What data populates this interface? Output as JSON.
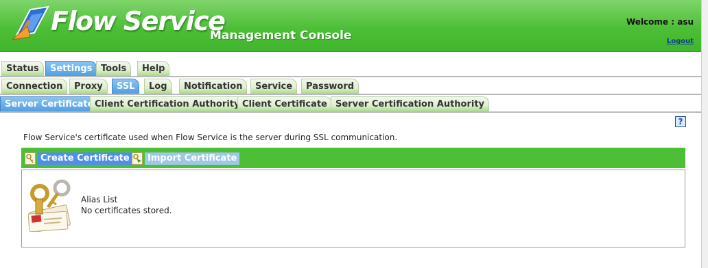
{
  "header": {
    "brand": "Flow Service",
    "subtitle": "Management Console",
    "welcome": "Welcome : asu",
    "logout": "Logout"
  },
  "tabs_main": [
    {
      "label": "Status",
      "active": false
    },
    {
      "label": "Settings",
      "active": true
    },
    {
      "label": "Tools",
      "active": false
    },
    {
      "label": "Help",
      "active": false
    }
  ],
  "tabs_settings": [
    {
      "label": "Connection",
      "active": false
    },
    {
      "label": "Proxy",
      "active": false
    },
    {
      "label": "SSL",
      "active": true
    },
    {
      "label": "Log",
      "active": false
    },
    {
      "label": "Notification",
      "active": false
    },
    {
      "label": "Service",
      "active": false
    },
    {
      "label": "Password",
      "active": false
    }
  ],
  "tabs_ssl": [
    {
      "label": "Server Certificate",
      "active": true
    },
    {
      "label": "Client Certification Authority",
      "active": false
    },
    {
      "label": "Client Certificate",
      "active": false
    },
    {
      "label": "Server Certification Authority",
      "active": false
    }
  ],
  "help_label": "?",
  "description": "Flow Service's certificate used when Flow Service is the server during SSL communication.",
  "toolbar": {
    "create_label": "Create Certificate",
    "import_label": "Import Certificate"
  },
  "alias": {
    "title": "Alias List",
    "empty_message": "No certificates stored."
  },
  "icons": {
    "brand": "logo-icon",
    "help": "help-icon",
    "create": "certificate-icon",
    "import": "import-certificate-icon",
    "art": "keys-certificate-icon"
  },
  "colors": {
    "header_green": "#4cbf36",
    "active_tab": "#4f9fe3",
    "toolbar_green": "#4cbf36",
    "create_button": "#4f8fe8",
    "import_button": "#9fc7e8"
  }
}
